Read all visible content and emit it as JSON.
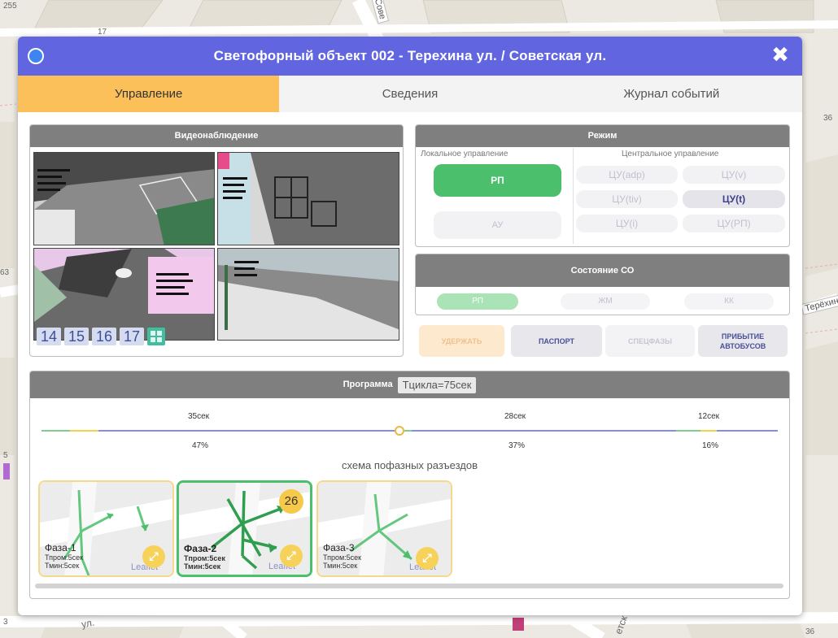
{
  "map": {
    "labels": [
      "255",
      "17",
      "36",
      "63",
      "5",
      "3",
      "36"
    ],
    "streets": [
      "Сове",
      "Терёхин",
      "ул.",
      "етск"
    ]
  },
  "dialog": {
    "title": "Светофорный объект 002 - Терехина ул. / Советская ул.",
    "close_icon": "✖",
    "tabs": [
      {
        "label": "Управление",
        "active": true
      },
      {
        "label": "Сведения",
        "active": false
      },
      {
        "label": "Журнал событий",
        "active": false
      }
    ]
  },
  "video": {
    "title": "Видеонаблюдение",
    "camera_numbers": [
      "14",
      "15",
      "16",
      "17"
    ],
    "grid_icon": "grid-icon"
  },
  "mode": {
    "title": "Режим",
    "local_label": "Локальное управление",
    "central_label": "Центральное управление",
    "local_buttons": [
      "РП",
      "АУ"
    ],
    "central_buttons": [
      "ЦУ(adp)",
      "ЦУ(v)",
      "ЦУ(tiv)",
      "ЦУ(t)",
      "ЦУ(i)",
      "ЦУ(РП)"
    ],
    "active_local": "РП",
    "active_central": "ЦУ(t)"
  },
  "state": {
    "title": "Состояние СО",
    "buttons": [
      "РП",
      "ЖМ",
      "КК"
    ],
    "active": "РП"
  },
  "actions": {
    "hold": "УДЕРЖАТЬ",
    "passport": "ПАСПОРТ",
    "special_phases": "СПЕЦФАЗЫ",
    "bus_arrival_line1": "ПРИБЫТИЕ",
    "bus_arrival_line2": "АВТОБУСОВ"
  },
  "program": {
    "title": "Программа",
    "cycle": "Тцикла=75сек",
    "phases": [
      {
        "time": "35сек",
        "pct": "47%"
      },
      {
        "time": "28сек",
        "pct": "37%"
      },
      {
        "time": "12сек",
        "pct": "16%"
      }
    ],
    "schema_title": "схема пофазных разъездов",
    "phase_cards": [
      {
        "name": "Фаза-1",
        "tprom": "Тпром:5сек",
        "tmin": "Тмин:5сек",
        "leaflet": "Leaflet",
        "active": false
      },
      {
        "name": "Фаза-2",
        "tprom": "Тпром:5сек",
        "tmin": "Тмин:5сек",
        "leaflet": "Leaflet",
        "active": true,
        "timer": "26"
      },
      {
        "name": "Фаза-3",
        "tprom": "Тпром:5сек",
        "tmin": "Тмин:5сек",
        "leaflet": "Leaflet",
        "active": false
      }
    ],
    "expand_icon": "⤢"
  },
  "colors": {
    "title_bar": "#6166e0",
    "active_tab": "#fbc05a",
    "green": "#4bbf6b",
    "panel_header": "#7f7f7f",
    "timer": "#f7c948"
  }
}
